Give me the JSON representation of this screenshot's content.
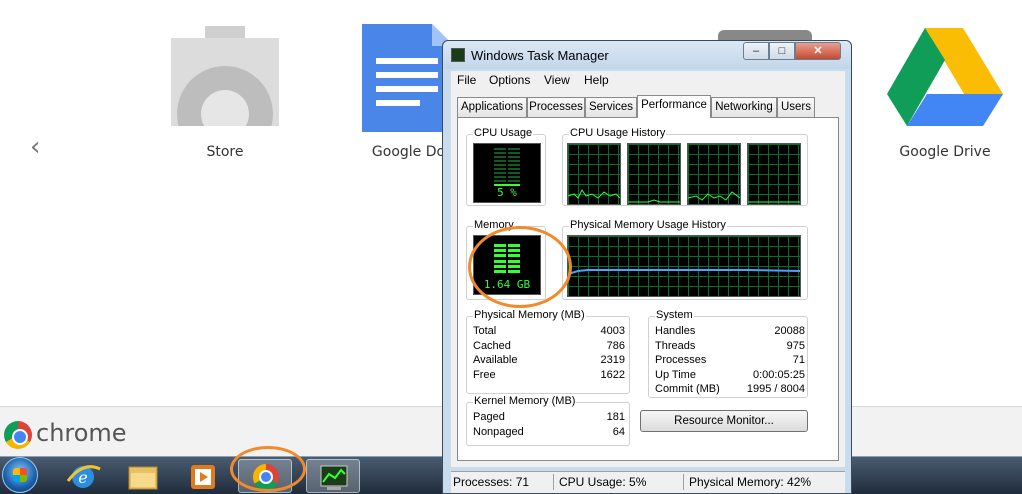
{
  "launcher": {
    "prev_arrow": "‹",
    "apps": [
      {
        "label": "Store"
      },
      {
        "label": "Google Docs"
      },
      {
        "label": "Google Drive"
      }
    ]
  },
  "chrome_strip": {
    "brand": "chrome"
  },
  "taskbar": {
    "items": [
      "start-button",
      "internet-explorer",
      "windows-explorer",
      "media-player",
      "google-chrome",
      "task-manager"
    ]
  },
  "task_manager": {
    "title": "Windows Task Manager",
    "window_buttons": {
      "minimize": "–",
      "maximize": "□",
      "close": "✕"
    },
    "menu": [
      "File",
      "Options",
      "View",
      "Help"
    ],
    "tabs": [
      "Applications",
      "Processes",
      "Services",
      "Performance",
      "Networking",
      "Users"
    ],
    "active_tab": "Performance",
    "cpu_usage": {
      "title": "CPU Usage",
      "value": "5 %"
    },
    "cpu_history": {
      "title": "CPU Usage History"
    },
    "memory": {
      "title": "Memory",
      "value": "1.64 GB"
    },
    "memory_history": {
      "title": "Physical Memory Usage History"
    },
    "physical_memory": {
      "title": "Physical Memory (MB)",
      "rows": [
        {
          "k": "Total",
          "v": "4003"
        },
        {
          "k": "Cached",
          "v": "786"
        },
        {
          "k": "Available",
          "v": "2319"
        },
        {
          "k": "Free",
          "v": "1622"
        }
      ]
    },
    "kernel_memory": {
      "title": "Kernel Memory (MB)",
      "rows": [
        {
          "k": "Paged",
          "v": "181"
        },
        {
          "k": "Nonpaged",
          "v": "64"
        }
      ]
    },
    "system": {
      "title": "System",
      "rows": [
        {
          "k": "Handles",
          "v": "20088"
        },
        {
          "k": "Threads",
          "v": "975"
        },
        {
          "k": "Processes",
          "v": "71"
        },
        {
          "k": "Up Time",
          "v": "0:00:05:25"
        },
        {
          "k": "Commit (MB)",
          "v": "1995 / 8004"
        }
      ]
    },
    "resource_monitor_button": "Resource Monitor...",
    "status": {
      "processes": "Processes: 71",
      "cpu": "CPU Usage: 5%",
      "memory": "Physical Memory: 42%"
    }
  },
  "colors": {
    "highlight": "#f08a2c",
    "graph_green": "#33ff33",
    "graph_grid": "#0d6b2e"
  }
}
